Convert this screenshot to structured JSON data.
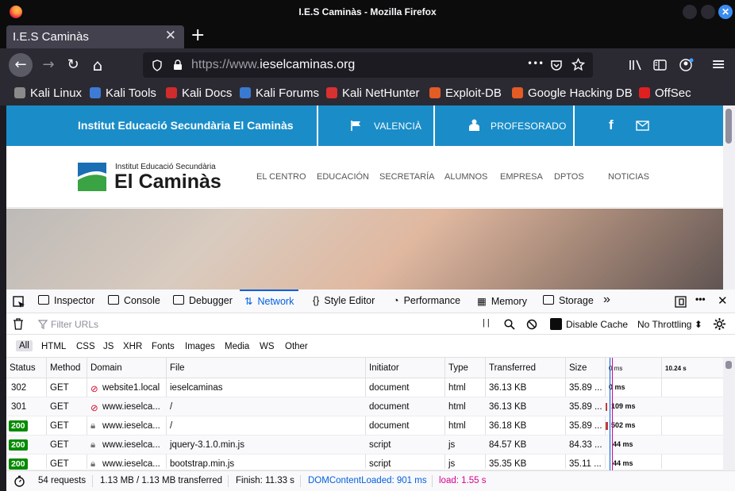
{
  "window": {
    "title": "I.E.S Caminàs - Mozilla Firefox",
    "close_glyph": "✕"
  },
  "tab": {
    "label": "I.E.S Caminàs",
    "close_glyph": "✕",
    "new_tab_glyph": "+"
  },
  "nav": {
    "url_prefix": "https://www.",
    "url_domain": "ieselcaminas.org",
    "back_glyph": "←",
    "forward_glyph": "→",
    "reload_glyph": "↻",
    "home_glyph": "⌂",
    "more_glyph": "•••",
    "menu_glyph": "≡"
  },
  "bookmarks": [
    {
      "label": "Kali Linux",
      "color": "#8a8a8a"
    },
    {
      "label": "Kali Tools",
      "color": "#3d7bd6"
    },
    {
      "label": "Kali Docs",
      "color": "#d12b2b"
    },
    {
      "label": "Kali Forums",
      "color": "#3a79d0"
    },
    {
      "label": "Kali NetHunter",
      "color": "#d93030"
    },
    {
      "label": "Exploit-DB",
      "color": "#e35b25"
    },
    {
      "label": "Google Hacking DB",
      "color": "#e35b25"
    },
    {
      "label": "OffSec",
      "color": "#e02020"
    }
  ],
  "site": {
    "top_title": "Institut Educació Secundària El Caminàs",
    "valencia": "VALENCIÀ",
    "profesorado": "PROFESORADO",
    "logo_sub": "Institut Educació Secundària",
    "logo_main": "El Caminàs",
    "menu": [
      "EL CENTRO",
      "EDUCACIÓN",
      "SECRETARÍA",
      "ALUMNOS",
      "EMPRESA",
      "DPTOS",
      "NOTICIAS"
    ],
    "brand_color": "#1a8dc8"
  },
  "devtools": {
    "tabs": [
      "Inspector",
      "Console",
      "Debugger",
      "Network",
      "Style Editor",
      "Performance",
      "Memory",
      "Storage"
    ],
    "selected_tab": "Network",
    "filter_placeholder": "Filter URLs",
    "pause_glyph": "| |",
    "disable_cache": "Disable Cache",
    "throttling": "No Throttling ⬍",
    "types": [
      "All",
      "HTML",
      "CSS",
      "JS",
      "XHR",
      "Fonts",
      "Images",
      "Media",
      "WS",
      "Other"
    ],
    "columns": {
      "status": "Status",
      "method": "Method",
      "domain": "Domain",
      "file": "File",
      "initiator": "Initiator",
      "type": "Type",
      "transferred": "Transferred",
      "size": "Size",
      "wf_start": "0 ms",
      "wf_end": "10.24 s"
    },
    "rows": [
      {
        "status": "302",
        "method": "GET",
        "domain": "website1.local",
        "file": "ieselcaminas",
        "initiator": "document",
        "type": "html",
        "transferred": "36.13 KB",
        "size": "35.89 ...",
        "timing": "0 ms"
      },
      {
        "status": "301",
        "method": "GET",
        "domain": "www.ieselca...",
        "file": "/",
        "initiator": "document",
        "type": "html",
        "transferred": "36.13 KB",
        "size": "35.89 ...",
        "timing": "109 ms"
      },
      {
        "status": "200",
        "method": "GET",
        "domain": "www.ieselca...",
        "file": "/",
        "initiator": "document",
        "type": "html",
        "transferred": "36.18 KB",
        "size": "35.89 ...",
        "timing": "502 ms"
      },
      {
        "status": "200",
        "method": "GET",
        "domain": "www.ieselca...",
        "file": "jquery-3.1.0.min.js",
        "initiator": "script",
        "type": "js",
        "transferred": "84.57 KB",
        "size": "84.33 ...",
        "timing": "44 ms"
      },
      {
        "status": "200",
        "method": "GET",
        "domain": "www.ieselca...",
        "file": "bootstrap.min.js",
        "initiator": "script",
        "type": "js",
        "transferred": "35.35 KB",
        "size": "35.11 ...",
        "timing": "44 ms"
      }
    ],
    "summary": {
      "requests": "54 requests",
      "transferred": "1.13 MB / 1.13 MB transferred",
      "finish": "Finish: 11.33 s",
      "domcontent": "DOMContentLoaded: 901 ms",
      "load": "load: 1.55 s",
      "dom_color": "#0060df",
      "load_color": "#d7008f"
    }
  }
}
